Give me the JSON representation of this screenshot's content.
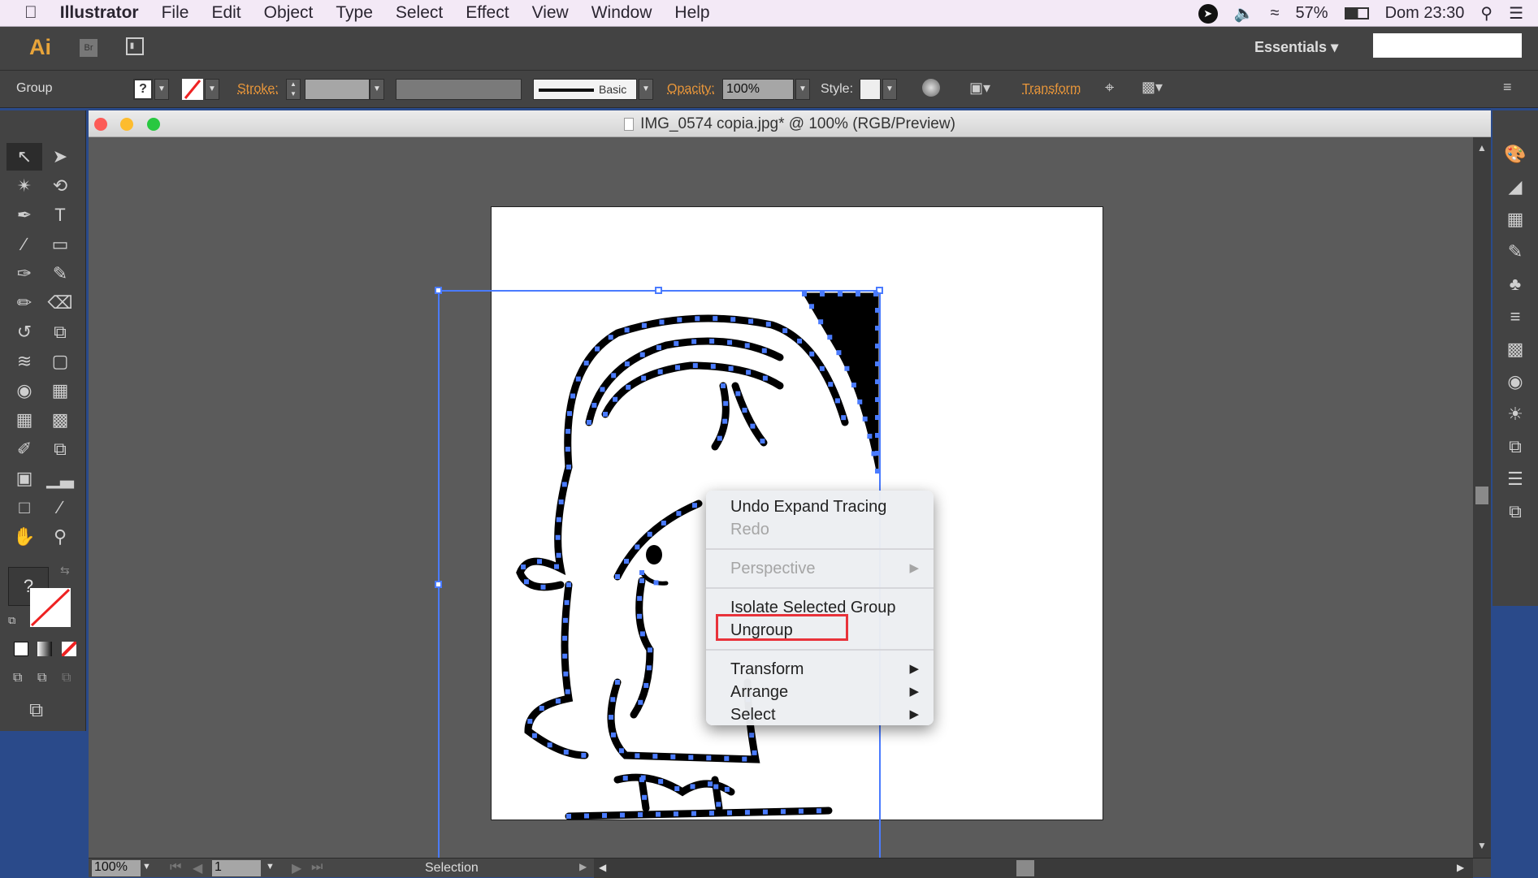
{
  "menubar": {
    "app": "Illustrator",
    "items": [
      "File",
      "Edit",
      "Object",
      "Type",
      "Select",
      "Effect",
      "View",
      "Window",
      "Help"
    ],
    "battery": "57%",
    "clock": "Dom 23:30"
  },
  "appbar": {
    "logo": "Ai",
    "bridge": "Br",
    "workspace": "Essentials",
    "search_value": ""
  },
  "control": {
    "selection_type": "Group",
    "fill": "?",
    "stroke_label": "Stroke:",
    "brush": "Basic",
    "opacity_label": "Opacity:",
    "opacity": "100%",
    "style_label": "Style:",
    "transform_label": "Transform"
  },
  "document": {
    "title": "IMG_0574 copia.jpg* @ 100% (RGB/Preview)"
  },
  "toolbox": {
    "fill_label": "?"
  },
  "context_menu": {
    "items": [
      {
        "label": "Undo Expand Tracing",
        "enabled": true
      },
      {
        "label": "Redo",
        "enabled": false
      },
      {
        "label": "Perspective",
        "enabled": false,
        "submenu": true
      },
      {
        "label": "Isolate Selected Group",
        "enabled": true
      },
      {
        "label": "Ungroup",
        "enabled": true,
        "highlighted": true
      },
      {
        "label": "Transform",
        "enabled": true,
        "submenu": true
      },
      {
        "label": "Arrange",
        "enabled": true,
        "submenu": true
      },
      {
        "label": "Select",
        "enabled": true,
        "submenu": true
      }
    ]
  },
  "status": {
    "zoom": "100%",
    "artboard": "1",
    "tool": "Selection"
  },
  "colors": {
    "selection": "#4a7bff",
    "highlight_box": "#e8323a",
    "accent": "#e8963a"
  }
}
